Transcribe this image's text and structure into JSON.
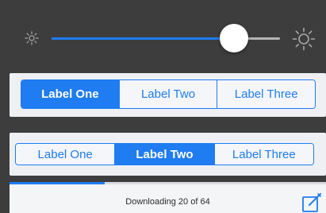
{
  "brightness": {
    "level": 0.8,
    "min_icon": "sun-small-icon",
    "max_icon": "sun-large-icon"
  },
  "segmented_one": {
    "segments": [
      "Label One",
      "Label Two",
      "Label Three"
    ],
    "selected_index": 0
  },
  "segmented_two": {
    "segments": [
      "Label One",
      "Label Two",
      "Label Three"
    ],
    "selected_index": 1
  },
  "download": {
    "status_text": "Downloading 20 of 64",
    "progress": 0.3,
    "action_icon": "compose-icon"
  },
  "colors": {
    "accent": "#1f7cf1",
    "background": "#3d3d3d",
    "panel": "#eef0f4"
  }
}
